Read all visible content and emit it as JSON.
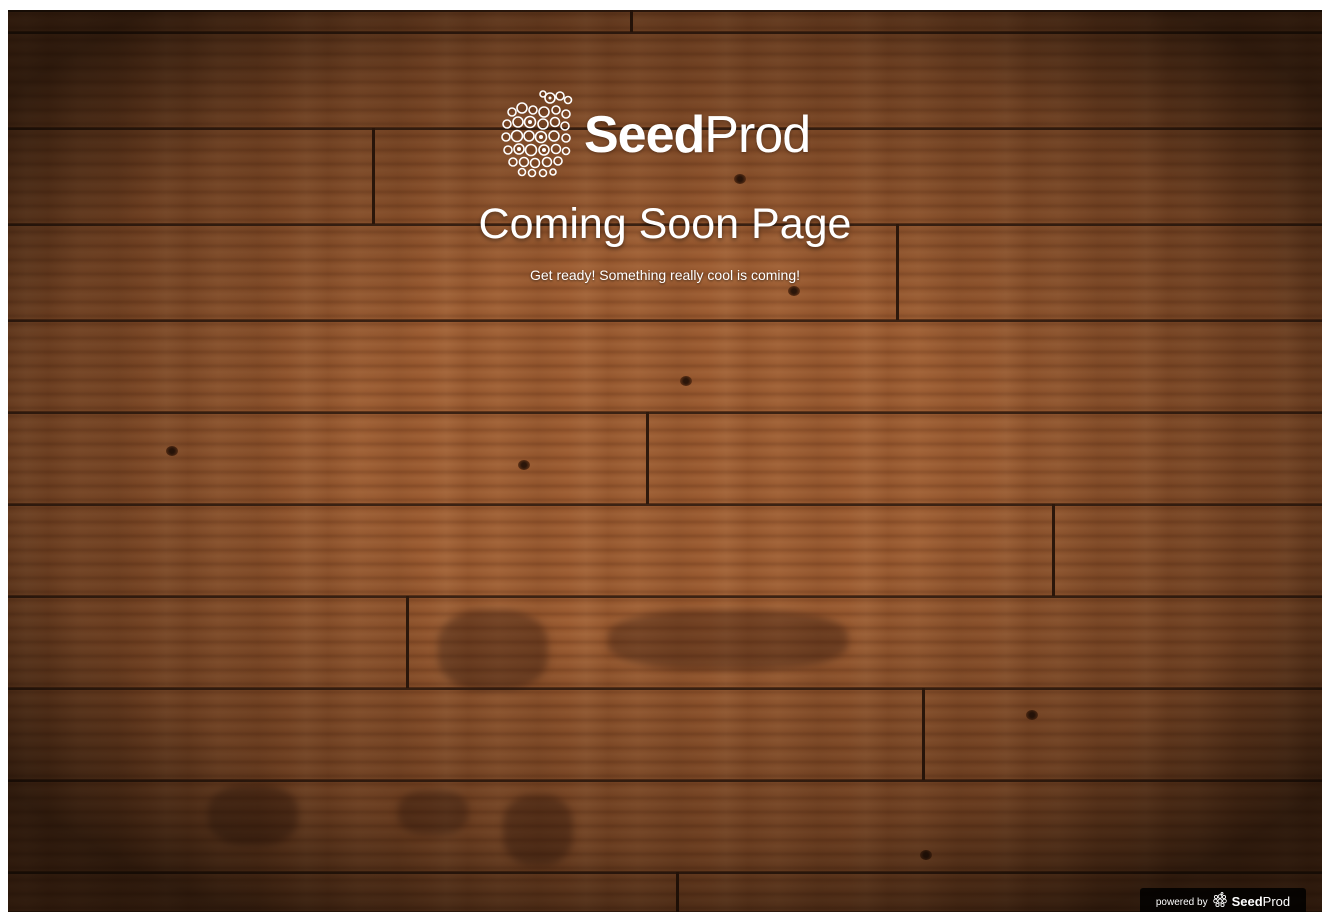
{
  "brand": {
    "name_bold": "Seed",
    "name_light": "Prod",
    "logo_icon": "seedprod-apple-icon"
  },
  "hero": {
    "headline": "Coming Soon Page",
    "subline": "Get ready! Something really cool is coming!"
  },
  "footer_badge": {
    "prefix": "powered by",
    "brand_bold": "Seed",
    "brand_light": "Prod"
  },
  "colors": {
    "wood": "#9a5a30",
    "text": "#ffffff",
    "badge_bg": "#111111"
  }
}
